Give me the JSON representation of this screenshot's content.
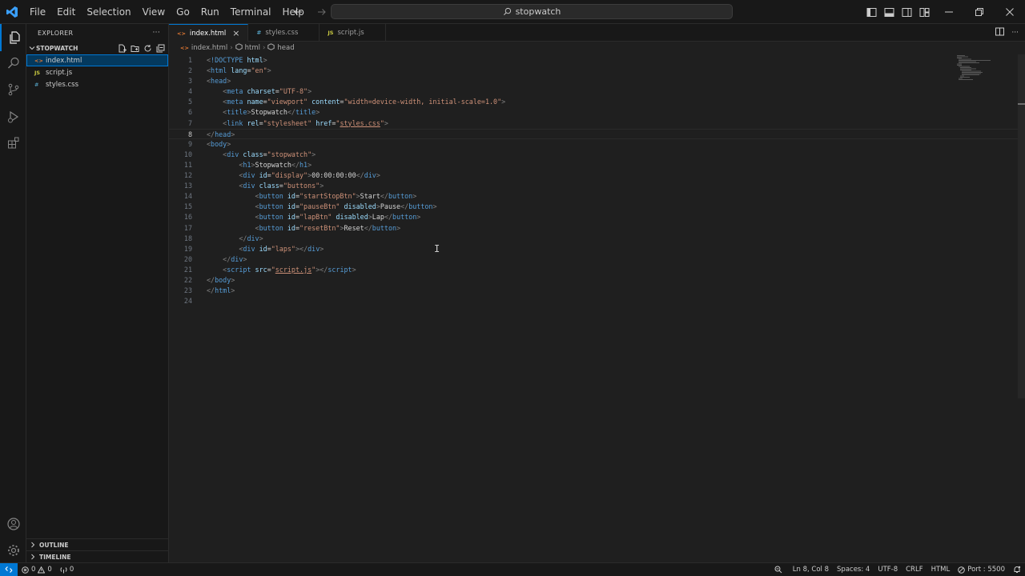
{
  "titlebar": {
    "menu": [
      "File",
      "Edit",
      "Selection",
      "View",
      "Go",
      "Run",
      "Terminal",
      "Help"
    ],
    "search_text": "stopwatch"
  },
  "sidebar": {
    "header": "EXPLORER",
    "more": "···",
    "folder": "STOPWATCH",
    "files": [
      {
        "icon": "<>",
        "name": "index.html"
      },
      {
        "icon": "JS",
        "name": "script.js"
      },
      {
        "icon": "#",
        "name": "styles.css"
      }
    ],
    "outline": "OUTLINE",
    "timeline": "TIMELINE"
  },
  "tabs": [
    {
      "icon": "<>",
      "label": "index.html"
    },
    {
      "icon": "#",
      "label": "styles.css"
    },
    {
      "icon": "JS",
      "label": "script.js"
    }
  ],
  "tab_close": "×",
  "breadcrumb": {
    "icon": "<>",
    "file": "index.html",
    "html": "html",
    "head": "head",
    "sep": "›"
  },
  "editor": {
    "current_line": 8,
    "lines": [
      {
        "n": "1",
        "s": [
          [
            "a",
            "<"
          ],
          [
            "t",
            "!DOCTYPE"
          ],
          [
            "x",
            " "
          ],
          [
            "r",
            "html"
          ],
          [
            "a",
            ">"
          ]
        ]
      },
      {
        "n": "2",
        "s": [
          [
            "a",
            "<"
          ],
          [
            "t",
            "html"
          ],
          [
            "x",
            " "
          ],
          [
            "r",
            "lang"
          ],
          [
            "x",
            "="
          ],
          [
            "s",
            "\"en\""
          ],
          [
            "a",
            ">"
          ]
        ]
      },
      {
        "n": "3",
        "s": [
          [
            "a",
            "<"
          ],
          [
            "t",
            "head"
          ],
          [
            "a",
            ">"
          ]
        ]
      },
      {
        "n": "4",
        "s": [
          [
            "x",
            "    "
          ],
          [
            "a",
            "<"
          ],
          [
            "t",
            "meta"
          ],
          [
            "x",
            " "
          ],
          [
            "r",
            "charset"
          ],
          [
            "x",
            "="
          ],
          [
            "s",
            "\"UTF-8\""
          ],
          [
            "a",
            ">"
          ]
        ]
      },
      {
        "n": "5",
        "s": [
          [
            "x",
            "    "
          ],
          [
            "a",
            "<"
          ],
          [
            "t",
            "meta"
          ],
          [
            "x",
            " "
          ],
          [
            "r",
            "name"
          ],
          [
            "x",
            "="
          ],
          [
            "s",
            "\"viewport\""
          ],
          [
            "x",
            " "
          ],
          [
            "r",
            "content"
          ],
          [
            "x",
            "="
          ],
          [
            "s",
            "\"width=device-width, initial-scale=1.0\""
          ],
          [
            "a",
            ">"
          ]
        ]
      },
      {
        "n": "6",
        "s": [
          [
            "x",
            "    "
          ],
          [
            "a",
            "<"
          ],
          [
            "t",
            "title"
          ],
          [
            "a",
            ">"
          ],
          [
            "x",
            "Stopwatch"
          ],
          [
            "a",
            "</"
          ],
          [
            "t",
            "title"
          ],
          [
            "a",
            ">"
          ]
        ]
      },
      {
        "n": "7",
        "s": [
          [
            "x",
            "    "
          ],
          [
            "a",
            "<"
          ],
          [
            "t",
            "link"
          ],
          [
            "x",
            " "
          ],
          [
            "r",
            "rel"
          ],
          [
            "x",
            "="
          ],
          [
            "s",
            "\"stylesheet\""
          ],
          [
            "x",
            " "
          ],
          [
            "r",
            "href"
          ],
          [
            "x",
            "="
          ],
          [
            "s",
            "\""
          ],
          [
            "u",
            "styles.css"
          ],
          [
            "s",
            "\""
          ],
          [
            "a",
            ">"
          ]
        ]
      },
      {
        "n": "8",
        "s": [
          [
            "a",
            "</"
          ],
          [
            "t",
            "head"
          ],
          [
            "a",
            ">"
          ]
        ]
      },
      {
        "n": "9",
        "s": [
          [
            "a",
            "<"
          ],
          [
            "t",
            "body"
          ],
          [
            "a",
            ">"
          ]
        ]
      },
      {
        "n": "10",
        "s": [
          [
            "x",
            "    "
          ],
          [
            "a",
            "<"
          ],
          [
            "t",
            "div"
          ],
          [
            "x",
            " "
          ],
          [
            "r",
            "class"
          ],
          [
            "x",
            "="
          ],
          [
            "s",
            "\"stopwatch\""
          ],
          [
            "a",
            ">"
          ]
        ]
      },
      {
        "n": "11",
        "s": [
          [
            "x",
            "        "
          ],
          [
            "a",
            "<"
          ],
          [
            "t",
            "h1"
          ],
          [
            "a",
            ">"
          ],
          [
            "x",
            "Stopwatch"
          ],
          [
            "a",
            "</"
          ],
          [
            "t",
            "h1"
          ],
          [
            "a",
            ">"
          ]
        ]
      },
      {
        "n": "12",
        "s": [
          [
            "x",
            "        "
          ],
          [
            "a",
            "<"
          ],
          [
            "t",
            "div"
          ],
          [
            "x",
            " "
          ],
          [
            "r",
            "id"
          ],
          [
            "x",
            "="
          ],
          [
            "s",
            "\"display\""
          ],
          [
            "a",
            ">"
          ],
          [
            "x",
            "00:00:00:00"
          ],
          [
            "a",
            "</"
          ],
          [
            "t",
            "div"
          ],
          [
            "a",
            ">"
          ]
        ]
      },
      {
        "n": "13",
        "s": [
          [
            "x",
            "        "
          ],
          [
            "a",
            "<"
          ],
          [
            "t",
            "div"
          ],
          [
            "x",
            " "
          ],
          [
            "r",
            "class"
          ],
          [
            "x",
            "="
          ],
          [
            "s",
            "\"buttons\""
          ],
          [
            "a",
            ">"
          ]
        ]
      },
      {
        "n": "14",
        "s": [
          [
            "x",
            "            "
          ],
          [
            "a",
            "<"
          ],
          [
            "t",
            "button"
          ],
          [
            "x",
            " "
          ],
          [
            "r",
            "id"
          ],
          [
            "x",
            "="
          ],
          [
            "s",
            "\"startStopBtn\""
          ],
          [
            "a",
            ">"
          ],
          [
            "x",
            "Start"
          ],
          [
            "a",
            "</"
          ],
          [
            "t",
            "button"
          ],
          [
            "a",
            ">"
          ]
        ]
      },
      {
        "n": "15",
        "s": [
          [
            "x",
            "            "
          ],
          [
            "a",
            "<"
          ],
          [
            "t",
            "button"
          ],
          [
            "x",
            " "
          ],
          [
            "r",
            "id"
          ],
          [
            "x",
            "="
          ],
          [
            "s",
            "\"pauseBtn\""
          ],
          [
            "x",
            " "
          ],
          [
            "r",
            "disabled"
          ],
          [
            "a",
            ">"
          ],
          [
            "x",
            "Pause"
          ],
          [
            "a",
            "</"
          ],
          [
            "t",
            "button"
          ],
          [
            "a",
            ">"
          ]
        ]
      },
      {
        "n": "16",
        "s": [
          [
            "x",
            "            "
          ],
          [
            "a",
            "<"
          ],
          [
            "t",
            "button"
          ],
          [
            "x",
            " "
          ],
          [
            "r",
            "id"
          ],
          [
            "x",
            "="
          ],
          [
            "s",
            "\"lapBtn\""
          ],
          [
            "x",
            " "
          ],
          [
            "r",
            "disabled"
          ],
          [
            "a",
            ">"
          ],
          [
            "x",
            "Lap"
          ],
          [
            "a",
            "</"
          ],
          [
            "t",
            "button"
          ],
          [
            "a",
            ">"
          ]
        ]
      },
      {
        "n": "17",
        "s": [
          [
            "x",
            "            "
          ],
          [
            "a",
            "<"
          ],
          [
            "t",
            "button"
          ],
          [
            "x",
            " "
          ],
          [
            "r",
            "id"
          ],
          [
            "x",
            "="
          ],
          [
            "s",
            "\"resetBtn\""
          ],
          [
            "a",
            ">"
          ],
          [
            "x",
            "Reset"
          ],
          [
            "a",
            "</"
          ],
          [
            "t",
            "button"
          ],
          [
            "a",
            ">"
          ]
        ]
      },
      {
        "n": "18",
        "s": [
          [
            "x",
            "        "
          ],
          [
            "a",
            "</"
          ],
          [
            "t",
            "div"
          ],
          [
            "a",
            ">"
          ]
        ]
      },
      {
        "n": "19",
        "s": [
          [
            "x",
            "        "
          ],
          [
            "a",
            "<"
          ],
          [
            "t",
            "div"
          ],
          [
            "x",
            " "
          ],
          [
            "r",
            "id"
          ],
          [
            "x",
            "="
          ],
          [
            "s",
            "\"laps\""
          ],
          [
            "a",
            ">"
          ],
          [
            "a",
            "</"
          ],
          [
            "t",
            "div"
          ],
          [
            "a",
            ">"
          ]
        ]
      },
      {
        "n": "20",
        "s": [
          [
            "x",
            "    "
          ],
          [
            "a",
            "</"
          ],
          [
            "t",
            "div"
          ],
          [
            "a",
            ">"
          ]
        ]
      },
      {
        "n": "21",
        "s": [
          [
            "x",
            "    "
          ],
          [
            "a",
            "<"
          ],
          [
            "t",
            "script"
          ],
          [
            "x",
            " "
          ],
          [
            "r",
            "src"
          ],
          [
            "x",
            "="
          ],
          [
            "s",
            "\""
          ],
          [
            "u",
            "script.js"
          ],
          [
            "s",
            "\""
          ],
          [
            "a",
            ">"
          ],
          [
            "a",
            "</"
          ],
          [
            "t",
            "script"
          ],
          [
            "a",
            ">"
          ]
        ]
      },
      {
        "n": "22",
        "s": [
          [
            "a",
            "</"
          ],
          [
            "t",
            "body"
          ],
          [
            "a",
            ">"
          ]
        ]
      },
      {
        "n": "23",
        "s": [
          [
            "a",
            "</"
          ],
          [
            "t",
            "html"
          ],
          [
            "a",
            ">"
          ]
        ]
      },
      {
        "n": "24",
        "s": []
      }
    ]
  },
  "cursor_glyph": "I",
  "statusbar": {
    "errors": "0",
    "warnings": "0",
    "ports": "0",
    "position": "Ln 8, Col 8",
    "spaces": "Spaces: 4",
    "encoding": "UTF-8",
    "eol": "CRLF",
    "language": "HTML",
    "port": "Port : 5500"
  },
  "colors": {
    "accent": "#0078d4",
    "tag": "#569cd6",
    "attribute": "#9cdcfe",
    "string": "#ce9178"
  }
}
